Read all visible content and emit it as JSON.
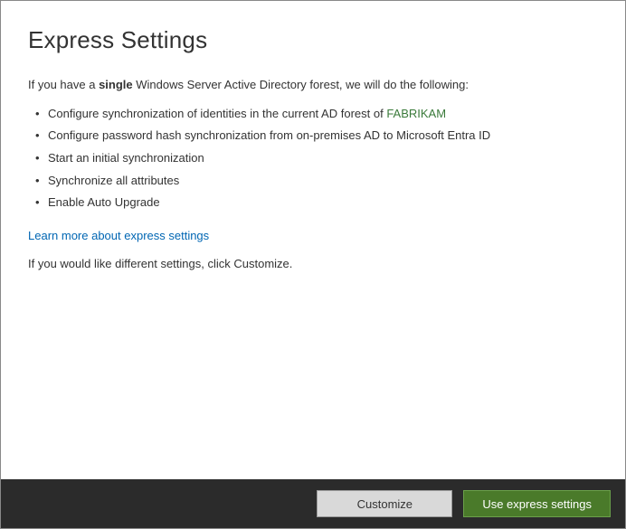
{
  "title": "Express Settings",
  "intro": {
    "prefix": "If you have a ",
    "bold_word": "single",
    "suffix": " Windows Server Active Directory forest, we will do the following:"
  },
  "bullets": [
    {
      "prefix": "Configure synchronization of identities in the current AD forest of ",
      "forest": "FABRIKAM"
    },
    {
      "text": "Configure password hash synchronization from on-premises AD to Microsoft Entra ID"
    },
    {
      "text": "Start an initial synchronization"
    },
    {
      "text": "Synchronize all attributes"
    },
    {
      "text": "Enable Auto Upgrade"
    }
  ],
  "learn_more": "Learn more about express settings",
  "customize_note": "If you would like different settings, click Customize.",
  "buttons": {
    "customize": "Customize",
    "express": "Use express settings"
  }
}
